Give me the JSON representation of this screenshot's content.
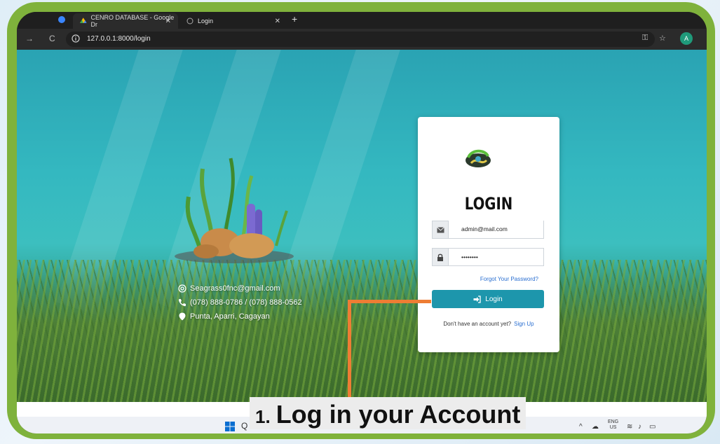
{
  "browser": {
    "tabs": [
      {
        "title": "CENRO DATABASE - Google Dr",
        "active": true
      },
      {
        "title": "Login",
        "active": false
      }
    ],
    "new_tab_icon": "plus-icon",
    "address": "127.0.0.1:8000/login"
  },
  "contact": {
    "email": "Seagrass0fnc@gmail.com",
    "phone": "(078) 888-0786 / (078) 888-0562",
    "location": "Punta, Aparri, Cagayan"
  },
  "login_card": {
    "title": "LOGIN",
    "email_value": "admin@mail.com",
    "password_value": "••••••••",
    "forgot_label": "Forgot Your Password?",
    "login_label": "Login",
    "no_account_text": "Don't have an account yet?",
    "signup_label": "Sign Up"
  },
  "taskbar": {
    "search_stub": "Q",
    "lang_top": "ENG",
    "lang_bottom": "US"
  },
  "annotation": {
    "number": "1.",
    "text": "Log in your Account"
  },
  "colors": {
    "frame": "#7fb23c",
    "login_button": "#1d96ac",
    "pointer": "#ee7d34"
  }
}
